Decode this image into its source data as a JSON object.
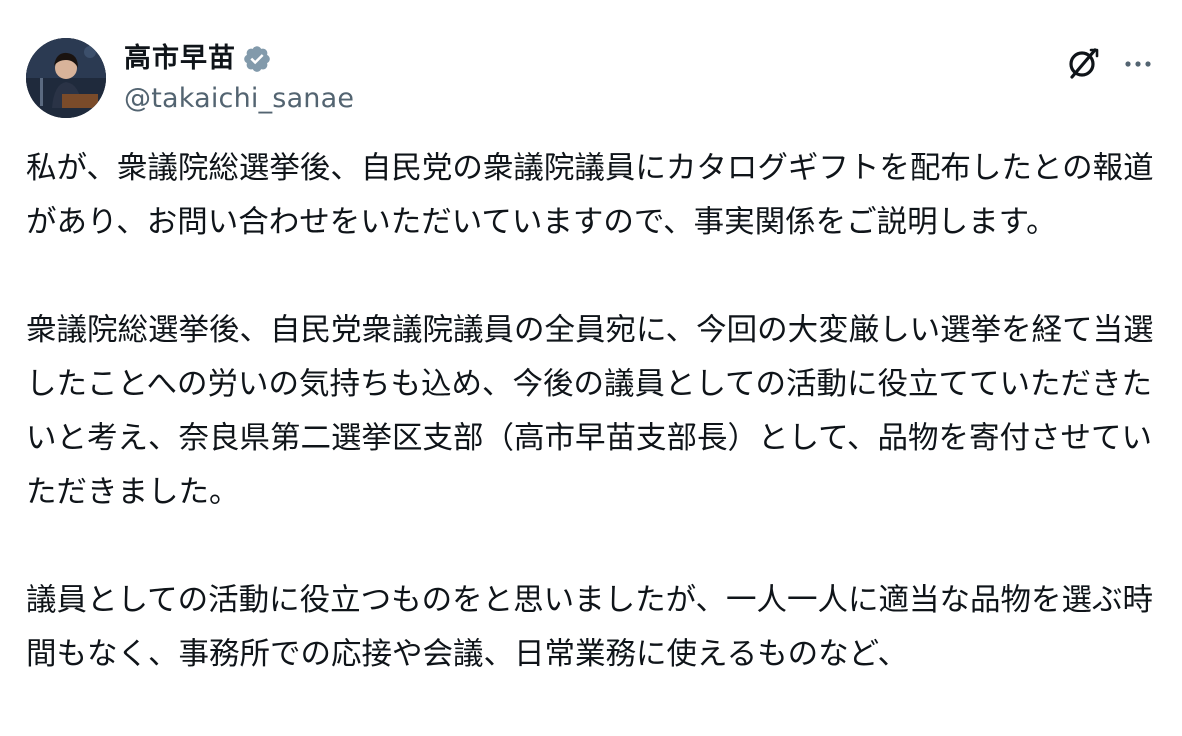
{
  "author": {
    "display_name": "高市早苗",
    "handle": "@takaichi_sanae",
    "verified": true
  },
  "icons": {
    "verified": "verified-badge-icon",
    "grok": "grok-icon",
    "more": "more-options-icon"
  },
  "colors": {
    "text": "#0f1419",
    "secondary_text": "#536471",
    "verified_badge": "#829aab"
  },
  "paragraphs": [
    "私が、衆議院総選挙後、自民党の衆議院議員にカタログギフトを配布したとの報道があり、お問い合わせをいただいていますので、事実関係をご説明します。",
    "衆議院総選挙後、自民党衆議院議員の全員宛に、今回の大変厳しい選挙を経て当選したことへの労いの気持ちも込め、今後の議員としての活動に役立てていただきたいと考え、奈良県第二選挙区支部（高市早苗支部長）として、品物を寄付させていただきました。",
    "議員としての活動に役立つものをと思いましたが、一人一人に適当な品物を選ぶ時間もなく、事務所での応接や会議、日常業務に使えるものなど、"
  ]
}
